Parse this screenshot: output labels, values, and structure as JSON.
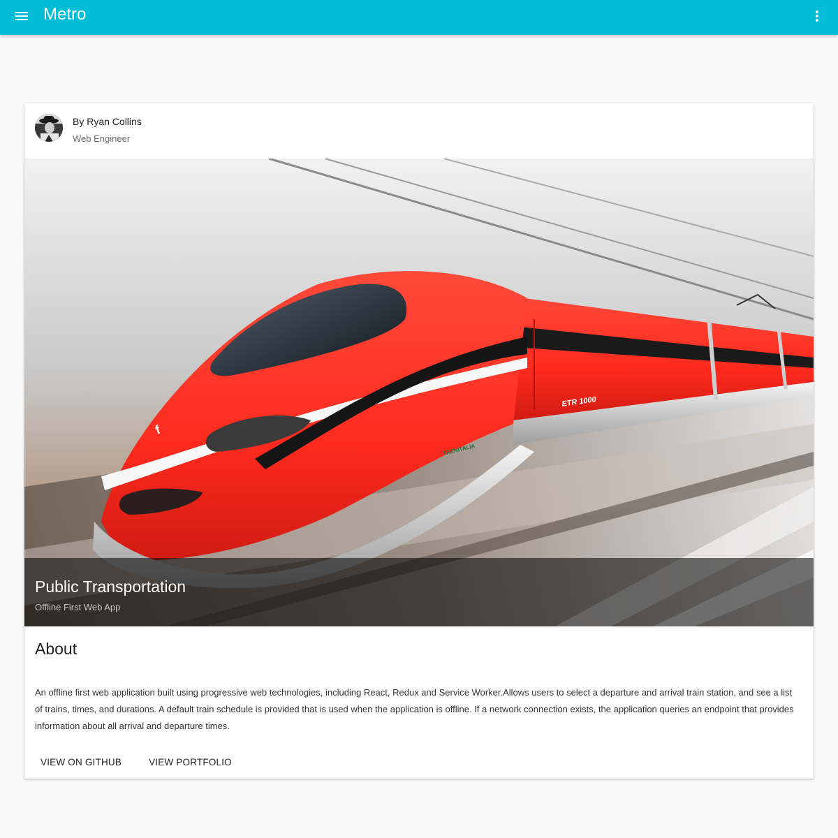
{
  "appbar": {
    "title": "Metro",
    "menu_icon": "hamburger-menu-icon",
    "more_icon": "more-vertical-icon",
    "color": "#00bcd4"
  },
  "card": {
    "author": {
      "name": "By Ryan Collins",
      "role": "Web Engineer"
    },
    "media": {
      "title": "Public Transportation",
      "subtitle": "Offline First Web App",
      "train_text": {
        "model": "ETR 1000",
        "brand": "TRENITALIA"
      }
    },
    "section_title": "About",
    "description": "An offline first web application built using progressive web technologies, including React, Redux and Service Worker.Allows users to select a departure and arrival train station, and see a list of trains, times, and durations. A default train schedule is provided that is used when the application is offline. If a network connection exists, the application queries an endpoint that provides information about all arrival and departure times.",
    "actions": {
      "github": "VIEW ON GITHUB",
      "portfolio": "VIEW PORTFOLIO"
    }
  }
}
